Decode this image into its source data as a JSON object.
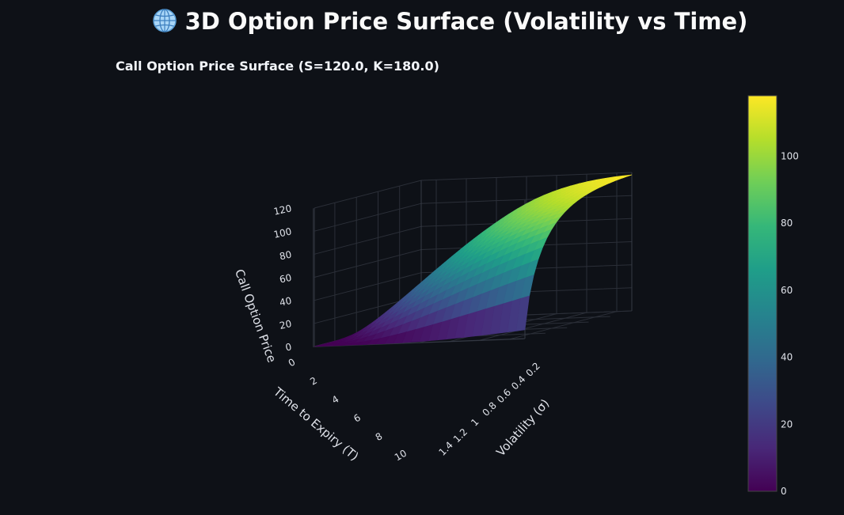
{
  "page": {
    "title": "3D Option Price Surface (Volatility vs Time)",
    "title_icon": "globe-icon"
  },
  "chart_data": {
    "type": "surface",
    "title": "Call Option Price Surface (S=120.0, K=180.0)",
    "x_axis": {
      "label": "Volatility (σ)",
      "ticks": [
        "0.2",
        "0.4",
        "0.6",
        "0.8",
        "1",
        "1.2",
        "1.4"
      ],
      "range": [
        0.1,
        1.5
      ]
    },
    "y_axis": {
      "label": "Time to Expiry (T)",
      "ticks": [
        "0",
        "2",
        "4",
        "6",
        "8",
        "10"
      ],
      "range": [
        0.1,
        10
      ]
    },
    "z_axis": {
      "label": "Call Option Price",
      "ticks": [
        "0",
        "20",
        "40",
        "60",
        "80",
        "100",
        "120"
      ],
      "range": [
        0,
        120
      ]
    },
    "colorscale": "Viridis",
    "colorbar": {
      "ticks": [
        "0",
        "20",
        "40",
        "60",
        "80",
        "100"
      ],
      "range": [
        0,
        118
      ]
    },
    "corner_values": {
      "low_vol_short_T": 0,
      "low_vol_long_T": 20,
      "high_vol_short_T": 12,
      "high_vol_long_T": 117
    },
    "grid": true
  }
}
